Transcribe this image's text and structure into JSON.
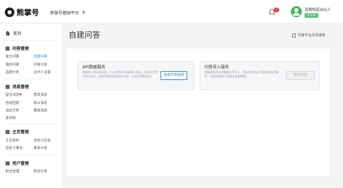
{
  "header": {
    "logo_text": "熊掌号",
    "platform_label": "熊掌号基础平台",
    "notification_count": "3",
    "user_name": "百度知道合伙人",
    "user_tag": "已认证"
  },
  "sidebar": {
    "home_label": "首页",
    "sections": [
      {
        "title": "问答管理",
        "items": [
          "官方问答",
          "自建问答",
          "我的问答",
          "问答分析",
          "品牌分析",
          "合伙人设置"
        ]
      },
      {
        "title": "消息管理",
        "items": [
          "留言消息",
          "群发消息",
          "自动回复",
          "默认消息",
          "消息分析",
          "模板消息",
          "素材库"
        ]
      },
      {
        "title": "主页管理",
        "items": [
          "主页资料",
          "自定义栏目",
          "自定义菜单",
          "菜单分析"
        ]
      },
      {
        "title": "用户管理",
        "items": [
          "粉丝管理",
          "粉丝分析"
        ]
      }
    ]
  },
  "main": {
    "title": "自建问答",
    "faq_link": "问答平台反馈通道",
    "cards": [
      {
        "title": "API数据服务",
        "desc": "将着您已建设的问答，可以使用API或者接入服务，实时同步到百度问答池，获取权威流量和用户信息，打造品牌影响力。",
        "button": "获取开发秘钥"
      },
      {
        "title": "问答导入服务",
        "desc": "将确定您的问答数据文件导入，完成审核后在百度知道站内展现，百度知道便于保管开发者数据。",
        "button": "暂未开放"
      }
    ]
  },
  "colors": {
    "accent": "#2f88e0",
    "badge": "#e4393c",
    "avatar": "#43b75c"
  }
}
